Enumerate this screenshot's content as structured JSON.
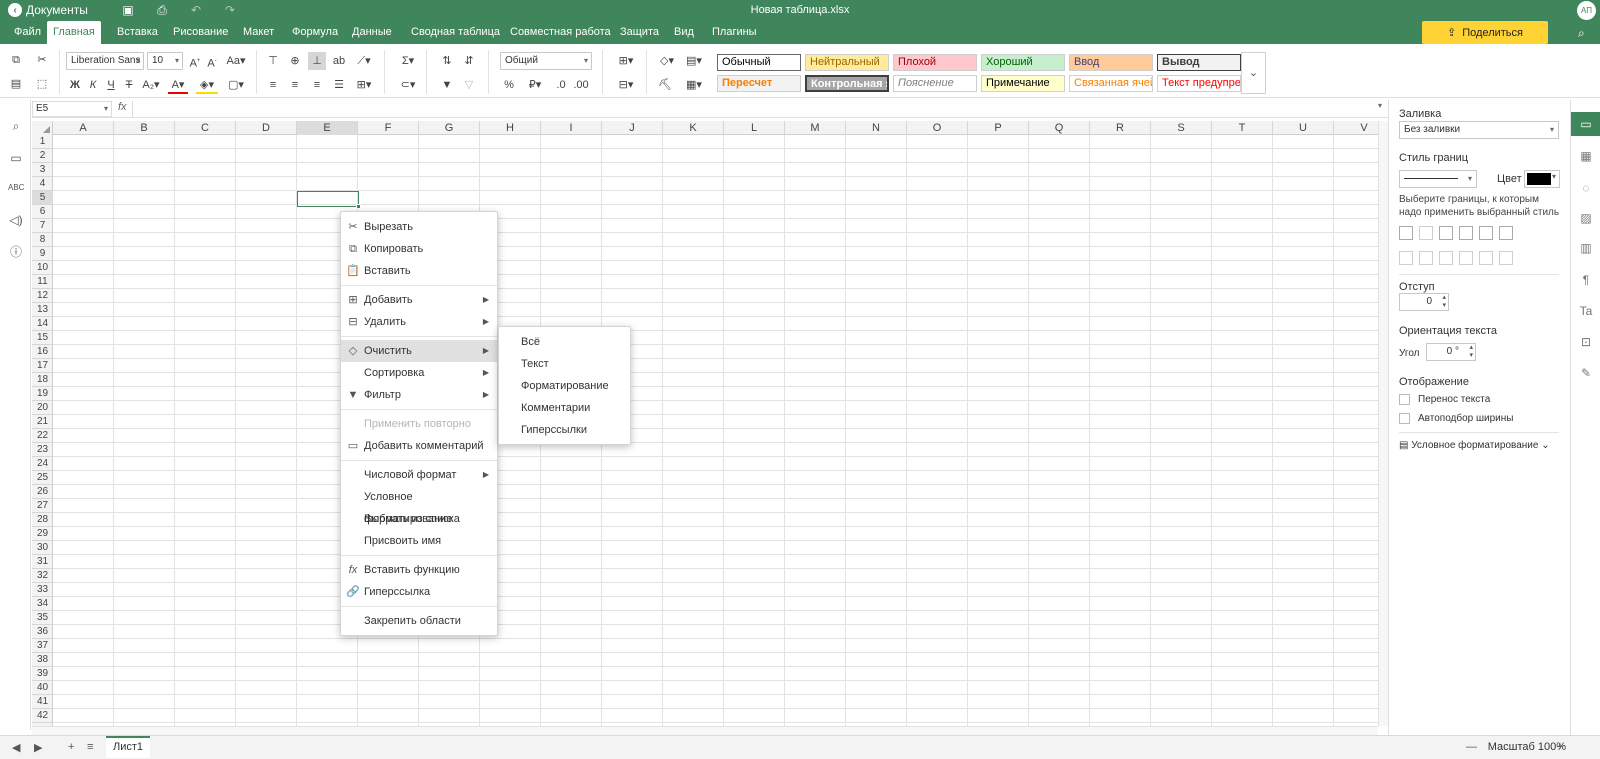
{
  "app": {
    "name": "Документы",
    "document_title": "Новая таблица.xlsx",
    "user_initials": "АП"
  },
  "tabs": [
    "Файл",
    "Главная",
    "Вставка",
    "Рисование",
    "Макет",
    "Формула",
    "Данные",
    "Сводная таблица",
    "Совместная работа",
    "Защита",
    "Вид",
    "Плагины"
  ],
  "active_tab": "Главная",
  "share_label": "Поделиться",
  "toolbar": {
    "font_name": "Liberation Sans",
    "font_size": "10",
    "number_format": "Общий",
    "bold": "Ж",
    "italic": "К",
    "underline": "Ч",
    "strike": "Т"
  },
  "cell_styles": [
    {
      "label": "Обычный",
      "bg": "#ffffff",
      "color": "#000000"
    },
    {
      "label": "Нейтральный",
      "bg": "#ffeb9c",
      "color": "#9c6500"
    },
    {
      "label": "Плохой",
      "bg": "#ffc7ce",
      "color": "#9c0006"
    },
    {
      "label": "Хороший",
      "bg": "#c6efce",
      "color": "#006100"
    },
    {
      "label": "Ввод",
      "bg": "#ffcc99",
      "color": "#3f3f76"
    },
    {
      "label": "Вывод",
      "bg": "#f2f2f2",
      "color": "#3f3f3f"
    },
    {
      "label": "Пересчет",
      "bg": "#f2f2f2",
      "color": "#fa7d00"
    },
    {
      "label": "Контрольная я",
      "bg": "#a5a5a5",
      "color": "#ffffff"
    },
    {
      "label": "Пояснение",
      "bg": "#ffffff",
      "color": "#7f7f7f"
    },
    {
      "label": "Примечание",
      "bg": "#ffffcc",
      "color": "#000000"
    },
    {
      "label": "Связанная ячей",
      "bg": "#ffffff",
      "color": "#fa7d00"
    },
    {
      "label": "Текст предупре",
      "bg": "#ffffff",
      "color": "#ff0000"
    }
  ],
  "formula_bar": {
    "name_box": "E5",
    "fx": "fx",
    "value": ""
  },
  "grid": {
    "columns": [
      "A",
      "B",
      "C",
      "D",
      "E",
      "F",
      "G",
      "H",
      "I",
      "J",
      "K",
      "L",
      "M",
      "N",
      "O",
      "P",
      "Q",
      "R",
      "S",
      "T",
      "U",
      "V"
    ],
    "rows": [
      "1",
      "2",
      "3",
      "4",
      "5",
      "6",
      "7",
      "8",
      "9",
      "10",
      "11",
      "12",
      "13",
      "14",
      "15",
      "16",
      "17",
      "18",
      "19",
      "20",
      "21",
      "22",
      "23",
      "24",
      "25",
      "26",
      "27",
      "28",
      "29",
      "30",
      "31",
      "32",
      "33",
      "34",
      "35",
      "36",
      "37",
      "38",
      "39",
      "40",
      "41",
      "42"
    ],
    "selected_column": "E",
    "selected_row": "5"
  },
  "context_menu": {
    "items": [
      {
        "label": "Вырезать",
        "icon": "cut-icon",
        "glyph": "✂"
      },
      {
        "label": "Копировать",
        "icon": "copy-icon",
        "glyph": "⧉"
      },
      {
        "label": "Вставить",
        "icon": "paste-icon",
        "glyph": "📋"
      },
      {
        "label": "Добавить",
        "icon": "insert-icon",
        "glyph": "⊞",
        "submenu": true
      },
      {
        "label": "Удалить",
        "icon": "delete-icon",
        "glyph": "⊟",
        "submenu": true
      },
      {
        "label": "Очистить",
        "icon": "eraser-icon",
        "glyph": "◇",
        "submenu": true,
        "highlighted": true
      },
      {
        "label": "Сортировка",
        "icon": "",
        "glyph": "",
        "submenu": true
      },
      {
        "label": "Фильтр",
        "icon": "filter-icon",
        "glyph": "▼",
        "submenu": true
      },
      {
        "label": "Применить повторно",
        "icon": "",
        "glyph": "",
        "disabled": true
      },
      {
        "label": "Добавить комментарий",
        "icon": "comment-icon",
        "glyph": "▭"
      },
      {
        "label": "Числовой формат",
        "icon": "",
        "glyph": "",
        "submenu": true
      },
      {
        "label": "Условное форматирование",
        "icon": "",
        "glyph": ""
      },
      {
        "label": "Выбрать из списка",
        "icon": "",
        "glyph": ""
      },
      {
        "label": "Присвоить имя",
        "icon": "",
        "glyph": ""
      },
      {
        "label": "Вставить функцию",
        "icon": "function-icon",
        "glyph": "fx"
      },
      {
        "label": "Гиперссылка",
        "icon": "link-icon",
        "glyph": "🔗"
      },
      {
        "label": "Закрепить области",
        "icon": "",
        "glyph": ""
      }
    ]
  },
  "submenu": {
    "items": [
      "Всё",
      "Текст",
      "Форматирование",
      "Комментарии",
      "Гиперссылки"
    ]
  },
  "right_panel": {
    "fill_label": "Заливка",
    "fill_value": "Без заливки",
    "border_style_label": "Стиль границ",
    "color_label": "Цвет",
    "border_color": "#000000",
    "border_hint": "Выберите границы, к которым надо применить выбранный стиль",
    "indent_label": "Отступ",
    "indent_value": "0",
    "orientation_label": "Ориентация текста",
    "angle_label": "Угол",
    "angle_value": "0 °",
    "display_label": "Отображение",
    "wrap_label": "Перенос текста",
    "autofit_label": "Автоподбор ширины",
    "cond_format_label": "Условное форматирование"
  },
  "sheetbar": {
    "sheet_name": "Лист1",
    "zoom_label": "Масштаб 100%"
  }
}
